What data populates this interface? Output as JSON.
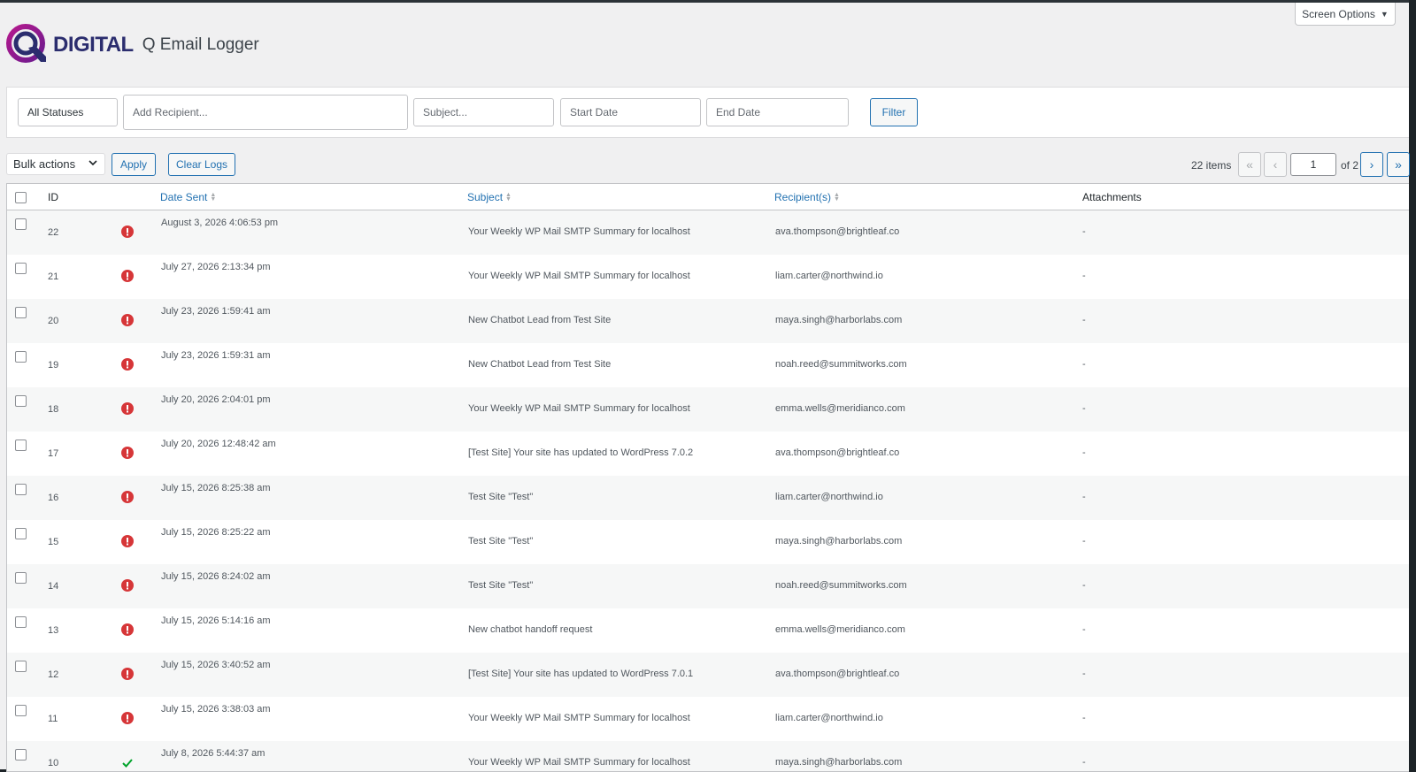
{
  "screen_options": {
    "label": "Screen Options",
    "caret": "▼"
  },
  "brand": {
    "logo_text": "DIGITAL",
    "page_title": "Q Email Logger"
  },
  "filters": {
    "status": {
      "selected": "All Statuses"
    },
    "recipient": {
      "placeholder": "Add Recipient..."
    },
    "subject": {
      "placeholder": "Subject..."
    },
    "start_date": {
      "placeholder": "Start Date"
    },
    "end_date": {
      "placeholder": "End Date"
    },
    "filter_label": "Filter"
  },
  "tablenav": {
    "bulk_actions": "Bulk actions",
    "apply_label": "Apply",
    "clear_logs_label": "Clear Logs",
    "items_count": "22 items",
    "first_page": "«",
    "prev_page": "‹",
    "current_page": "1",
    "of_pages": "of 2",
    "next_page": "›",
    "last_page": "»"
  },
  "table": {
    "headers": {
      "id": "ID",
      "date_sent": "Date Sent",
      "subject": "Subject",
      "recipients": "Recipient(s)",
      "attachments": "Attachments"
    },
    "status_colors": {
      "error": "#d63638",
      "success": "#00a32a"
    },
    "rows": [
      {
        "id": "22",
        "status": "error",
        "date": "August 3, 2026 4:06:53 pm",
        "subject": "Your Weekly WP Mail SMTP Summary for localhost",
        "recipient": "ava.thompson@brightleaf.co",
        "attachments": "-"
      },
      {
        "id": "21",
        "status": "error",
        "date": "July 27, 2026 2:13:34 pm",
        "subject": "Your Weekly WP Mail SMTP Summary for localhost",
        "recipient": "liam.carter@northwind.io",
        "attachments": "-"
      },
      {
        "id": "20",
        "status": "error",
        "date": "July 23, 2026 1:59:41 am",
        "subject": "New Chatbot Lead from Test Site",
        "recipient": "maya.singh@harborlabs.com",
        "attachments": "-"
      },
      {
        "id": "19",
        "status": "error",
        "date": "July 23, 2026 1:59:31 am",
        "subject": "New Chatbot Lead from Test Site",
        "recipient": "noah.reed@summitworks.com",
        "attachments": "-"
      },
      {
        "id": "18",
        "status": "error",
        "date": "July 20, 2026 2:04:01 pm",
        "subject": "Your Weekly WP Mail SMTP Summary for localhost",
        "recipient": "emma.wells@meridianco.com",
        "attachments": "-"
      },
      {
        "id": "17",
        "status": "error",
        "date": "July 20, 2026 12:48:42 am",
        "subject": "[Test Site] Your site has updated to WordPress 7.0.2",
        "recipient": "ava.thompson@brightleaf.co",
        "attachments": "-"
      },
      {
        "id": "16",
        "status": "error",
        "date": "July 15, 2026 8:25:38 am",
        "subject": "Test Site \"Test\"",
        "recipient": "liam.carter@northwind.io",
        "attachments": "-"
      },
      {
        "id": "15",
        "status": "error",
        "date": "July 15, 2026 8:25:22 am",
        "subject": "Test Site \"Test\"",
        "recipient": "maya.singh@harborlabs.com",
        "attachments": "-"
      },
      {
        "id": "14",
        "status": "error",
        "date": "July 15, 2026 8:24:02 am",
        "subject": "Test Site \"Test\"",
        "recipient": "noah.reed@summitworks.com",
        "attachments": "-"
      },
      {
        "id": "13",
        "status": "error",
        "date": "July 15, 2026 5:14:16 am",
        "subject": "New chatbot handoff request",
        "recipient": "emma.wells@meridianco.com",
        "attachments": "-"
      },
      {
        "id": "12",
        "status": "error",
        "date": "July 15, 2026 3:40:52 am",
        "subject": "[Test Site] Your site has updated to WordPress 7.0.1",
        "recipient": "ava.thompson@brightleaf.co",
        "attachments": "-"
      },
      {
        "id": "11",
        "status": "error",
        "date": "July 15, 2026 3:38:03 am",
        "subject": "Your Weekly WP Mail SMTP Summary for localhost",
        "recipient": "liam.carter@northwind.io",
        "attachments": "-"
      },
      {
        "id": "10",
        "status": "success",
        "date": "July 8, 2026 5:44:37 am",
        "subject": "Your Weekly WP Mail SMTP Summary for localhost",
        "recipient": "maya.singh@harborlabs.com",
        "attachments": "-"
      }
    ]
  }
}
